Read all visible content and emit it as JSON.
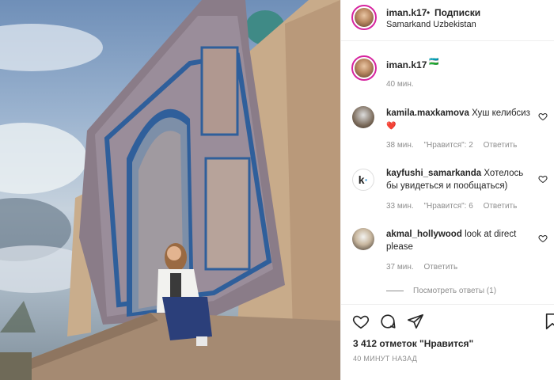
{
  "post": {
    "username": "iman.k17",
    "follow_dot": "•",
    "follow_label": "Подписки",
    "location": "Samarkand Uzbekistan",
    "caption_username": "iman.k17",
    "caption_emoji": "🇺🇿",
    "caption_time": "40 мин.",
    "likes": "3 412 отметок \"Нравится\"",
    "date": "40 МИНУТ НАЗАД"
  },
  "comments": [
    {
      "username": "kamila.maxkamova",
      "text": "Хуш келибсиз",
      "text_emoji": "❤️",
      "time": "38 мин.",
      "likes": "\"Нравится\": 2",
      "reply": "Ответить"
    },
    {
      "username": "kayfushi_samarkanda",
      "text": "Хотелось бы увидеться и пообщаться)",
      "time": "33 мин.",
      "likes": "\"Нравится\": 6",
      "reply": "Ответить"
    },
    {
      "username": "akmal_hollywood",
      "text": "look at direct please",
      "time": "37 мин.",
      "reply": "Ответить"
    }
  ],
  "view_replies": "Посмотреть ответы (1)",
  "colors": {
    "story_ring": "#d6249f",
    "text": "#262626",
    "muted": "#8e8e8e",
    "heart": "#ed4956"
  },
  "icons": [
    "heart-icon",
    "comment-icon",
    "share-icon",
    "bookmark-icon"
  ]
}
